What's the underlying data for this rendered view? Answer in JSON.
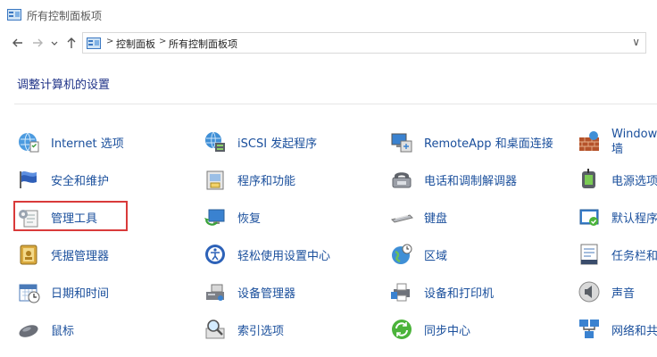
{
  "window": {
    "title": "所有控制面板项"
  },
  "nav": {
    "back_icon": "back-arrow-icon",
    "forward_icon": "forward-arrow-icon",
    "recent_icon": "chevron-down-icon",
    "up_icon": "up-arrow-icon"
  },
  "address": {
    "crumbs": [
      "控制面板",
      "所有控制面板项"
    ],
    "separator": ">",
    "dropdown_glyph": "∨"
  },
  "heading": "调整计算机的设置",
  "items": [
    {
      "label": "Internet 选项",
      "icon": "internet-options-icon"
    },
    {
      "label": "iSCSI 发起程序",
      "icon": "iscsi-icon"
    },
    {
      "label": "RemoteApp 和桌面连接",
      "icon": "remoteapp-icon"
    },
    {
      "label": "Windows 墙",
      "icon": "firewall-icon"
    },
    {
      "label": "安全和维护",
      "icon": "flag-icon"
    },
    {
      "label": "程序和功能",
      "icon": "programs-icon"
    },
    {
      "label": "电话和调制解调器",
      "icon": "phone-modem-icon"
    },
    {
      "label": "电源选项",
      "icon": "power-icon"
    },
    {
      "label": "管理工具",
      "icon": "admin-tools-icon"
    },
    {
      "label": "恢复",
      "icon": "recovery-icon"
    },
    {
      "label": "键盘",
      "icon": "keyboard-icon"
    },
    {
      "label": "默认程序",
      "icon": "default-programs-icon"
    },
    {
      "label": "凭据管理器",
      "icon": "credential-icon"
    },
    {
      "label": "轻松使用设置中心",
      "icon": "ease-of-access-icon"
    },
    {
      "label": "区域",
      "icon": "region-icon"
    },
    {
      "label": "任务栏和",
      "icon": "taskbar-icon"
    },
    {
      "label": "日期和时间",
      "icon": "calendar-icon"
    },
    {
      "label": "设备管理器",
      "icon": "device-manager-icon"
    },
    {
      "label": "设备和打印机",
      "icon": "printer-icon"
    },
    {
      "label": "声音",
      "icon": "sound-icon"
    },
    {
      "label": "鼠标",
      "icon": "mouse-icon"
    },
    {
      "label": "索引选项",
      "icon": "indexing-icon"
    },
    {
      "label": "同步中心",
      "icon": "sync-icon"
    },
    {
      "label": "网络和共",
      "icon": "network-icon"
    }
  ],
  "colors": {
    "link": "#1a4f9c",
    "heading": "#1e3287",
    "highlight": "#d93a3a"
  }
}
